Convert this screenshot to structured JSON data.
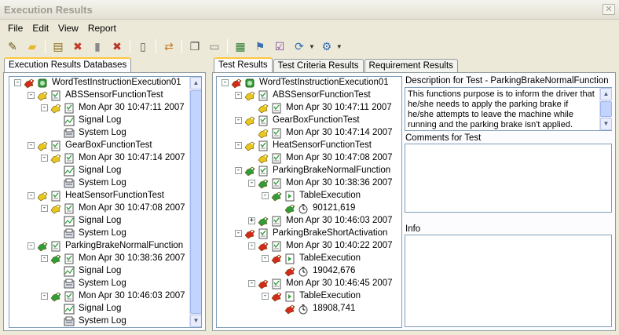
{
  "window": {
    "title": "Execution Results",
    "close_label": "✕"
  },
  "menu": [
    "File",
    "Edit",
    "View",
    "Report"
  ],
  "toolbar": {
    "buttons": [
      {
        "name": "edit-icon",
        "glyph": "✎",
        "color": "#6a5a1a"
      },
      {
        "name": "open-folder-icon",
        "glyph": "▰",
        "color": "#e8b730"
      },
      {
        "name": "database-icon",
        "glyph": "▤",
        "color": "#8a6d1c"
      },
      {
        "name": "delete-database-icon",
        "glyph": "✖",
        "color": "#c23b2a"
      },
      {
        "name": "cylinder-icon",
        "glyph": "▮",
        "color": "#8a8a8a"
      },
      {
        "name": "remove-icon",
        "glyph": "✖",
        "color": "#b8352b"
      },
      {
        "name": "notes-icon",
        "glyph": "▯",
        "color": "#5a5a5a"
      },
      {
        "name": "transfer-icon",
        "glyph": "⇄",
        "color": "#c8781d"
      },
      {
        "name": "copy-icon",
        "glyph": "❐",
        "color": "#4a4a4a"
      },
      {
        "name": "document-icon",
        "glyph": "▭",
        "color": "#7a7a7a"
      },
      {
        "name": "report-icon",
        "glyph": "▦",
        "color": "#2e7d32"
      },
      {
        "name": "filter-icon",
        "glyph": "⚑",
        "color": "#3a6fb0"
      },
      {
        "name": "checklist-icon",
        "glyph": "☑",
        "color": "#7a3f9a"
      },
      {
        "name": "export-icon",
        "glyph": "⟳",
        "color": "#2f6db5"
      },
      {
        "name": "settings-icon",
        "glyph": "⚙",
        "color": "#2f6db5"
      }
    ]
  },
  "left_tabs": [
    "Execution Results Databases"
  ],
  "right_tabs": [
    "Test Results",
    "Test Criteria Results",
    "Requirement Results"
  ],
  "left_tree": [
    {
      "lvl": 0,
      "exp": "-",
      "icons": [
        "red",
        "db"
      ],
      "label": "WordTestInstructionExecution01"
    },
    {
      "lvl": 1,
      "exp": "-",
      "icons": [
        "yellow",
        "doc"
      ],
      "label": "ABSSensorFunctionTest"
    },
    {
      "lvl": 2,
      "exp": "-",
      "icons": [
        "yellow",
        "doc"
      ],
      "label": "Mon Apr 30 10:47:11 2007"
    },
    {
      "lvl": 3,
      "exp": "",
      "icons": [
        "chart"
      ],
      "label": "Signal Log"
    },
    {
      "lvl": 3,
      "exp": "",
      "icons": [
        "log"
      ],
      "label": "System Log"
    },
    {
      "lvl": 1,
      "exp": "-",
      "icons": [
        "yellow",
        "doc"
      ],
      "label": "GearBoxFunctionTest"
    },
    {
      "lvl": 2,
      "exp": "-",
      "icons": [
        "yellow",
        "doc"
      ],
      "label": "Mon Apr 30 10:47:14 2007"
    },
    {
      "lvl": 3,
      "exp": "",
      "icons": [
        "chart"
      ],
      "label": "Signal Log"
    },
    {
      "lvl": 3,
      "exp": "",
      "icons": [
        "log"
      ],
      "label": "System Log"
    },
    {
      "lvl": 1,
      "exp": "-",
      "icons": [
        "yellow",
        "doc"
      ],
      "label": "HeatSensorFunctionTest"
    },
    {
      "lvl": 2,
      "exp": "-",
      "icons": [
        "yellow",
        "doc"
      ],
      "label": "Mon Apr 30 10:47:08 2007"
    },
    {
      "lvl": 3,
      "exp": "",
      "icons": [
        "chart"
      ],
      "label": "Signal Log"
    },
    {
      "lvl": 3,
      "exp": "",
      "icons": [
        "log"
      ],
      "label": "System Log"
    },
    {
      "lvl": 1,
      "exp": "-",
      "icons": [
        "green",
        "doc"
      ],
      "label": "ParkingBrakeNormalFunction"
    },
    {
      "lvl": 2,
      "exp": "-",
      "icons": [
        "green",
        "doc"
      ],
      "label": "Mon Apr 30 10:38:36 2007"
    },
    {
      "lvl": 3,
      "exp": "",
      "icons": [
        "chart"
      ],
      "label": "Signal Log"
    },
    {
      "lvl": 3,
      "exp": "",
      "icons": [
        "log"
      ],
      "label": "System Log"
    },
    {
      "lvl": 2,
      "exp": "-",
      "icons": [
        "green",
        "doc"
      ],
      "label": "Mon Apr 30 10:46:03 2007"
    },
    {
      "lvl": 3,
      "exp": "",
      "icons": [
        "chart"
      ],
      "label": "Signal Log"
    },
    {
      "lvl": 3,
      "exp": "",
      "icons": [
        "log"
      ],
      "label": "System Log"
    }
  ],
  "right_tree": [
    {
      "lvl": 0,
      "exp": "-",
      "icons": [
        "red",
        "db"
      ],
      "label": "WordTestInstructionExecution01"
    },
    {
      "lvl": 1,
      "exp": "-",
      "icons": [
        "yellow",
        "doc"
      ],
      "label": "ABSSensorFunctionTest"
    },
    {
      "lvl": 2,
      "exp": "",
      "icons": [
        "yellow",
        "doc"
      ],
      "label": "Mon Apr 30 10:47:11 2007"
    },
    {
      "lvl": 1,
      "exp": "-",
      "icons": [
        "yellow",
        "doc"
      ],
      "label": "GearBoxFunctionTest"
    },
    {
      "lvl": 2,
      "exp": "",
      "icons": [
        "yellow",
        "doc"
      ],
      "label": "Mon Apr 30 10:47:14 2007"
    },
    {
      "lvl": 1,
      "exp": "-",
      "icons": [
        "yellow",
        "doc"
      ],
      "label": "HeatSensorFunctionTest"
    },
    {
      "lvl": 2,
      "exp": "",
      "icons": [
        "yellow",
        "doc"
      ],
      "label": "Mon Apr 30 10:47:08 2007"
    },
    {
      "lvl": 1,
      "exp": "-",
      "icons": [
        "green",
        "doc"
      ],
      "label": "ParkingBrakeNormalFunction"
    },
    {
      "lvl": 2,
      "exp": "-",
      "icons": [
        "green",
        "doc"
      ],
      "label": "Mon Apr 30 10:38:36 2007"
    },
    {
      "lvl": 3,
      "exp": "-",
      "icons": [
        "green",
        "exec"
      ],
      "label": "TableExecution"
    },
    {
      "lvl": 4,
      "exp": "",
      "icons": [
        "green",
        "timer"
      ],
      "label": "90121,619"
    },
    {
      "lvl": 2,
      "exp": "+",
      "icons": [
        "green",
        "doc"
      ],
      "label": "Mon Apr 30 10:46:03 2007"
    },
    {
      "lvl": 1,
      "exp": "-",
      "icons": [
        "red",
        "doc"
      ],
      "label": "ParkingBrakeShortActivation"
    },
    {
      "lvl": 2,
      "exp": "-",
      "icons": [
        "red",
        "doc"
      ],
      "label": "Mon Apr 30 10:40:22 2007"
    },
    {
      "lvl": 3,
      "exp": "-",
      "icons": [
        "red",
        "exec"
      ],
      "label": "TableExecution"
    },
    {
      "lvl": 4,
      "exp": "",
      "icons": [
        "red",
        "timer"
      ],
      "label": "19042,676"
    },
    {
      "lvl": 2,
      "exp": "-",
      "icons": [
        "red",
        "doc"
      ],
      "label": "Mon Apr 30 10:46:45 2007"
    },
    {
      "lvl": 3,
      "exp": "-",
      "icons": [
        "red",
        "exec"
      ],
      "label": "TableExecution"
    },
    {
      "lvl": 4,
      "exp": "",
      "icons": [
        "red",
        "timer"
      ],
      "label": "18908,741"
    }
  ],
  "details": {
    "description_title": "Description for Test - ParkingBrakeNormalFunction",
    "description_text": "This functions purpose is to inform the driver that he/she needs to apply the parking brake if he/she attempts to leave the machine while running and the parking brake isn't applied.",
    "comments_title": "Comments for Test",
    "info_title": "Info"
  },
  "colors": {
    "red": "#d42a1e",
    "yellow": "#e8c81e",
    "green": "#2e9d3a",
    "accent": "#ffc83c"
  }
}
